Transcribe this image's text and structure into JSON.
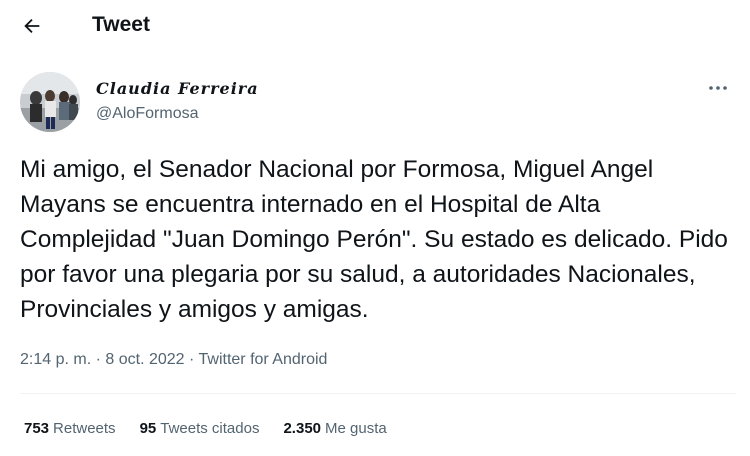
{
  "header": {
    "title": "Tweet",
    "back_icon": "back-arrow-icon"
  },
  "author": {
    "name": "Claudia Ferreira",
    "handle": "@AloFormosa"
  },
  "tweet": {
    "text": "Mi amigo, el Senador Nacional por Formosa, Miguel Angel Mayans se encuentra internado en el Hospital de Alta Complejidad \"Juan Domingo Perón\". Su estado es delicado. Pido por favor una plegaria por su salud, a autoridades Nacionales, Provinciales y amigos y amigas.",
    "time": "2:14 p. m.",
    "date": "8 oct. 2022",
    "source": "Twitter for Android",
    "separator": "·"
  },
  "stats": {
    "retweets_count": "753",
    "retweets_label": "Retweets",
    "quotes_count": "95",
    "quotes_label": "Tweets citados",
    "likes_count": "2.350",
    "likes_label": "Me gusta"
  },
  "colors": {
    "text_primary": "#0f1419",
    "text_secondary": "#536471",
    "divider": "#eff3f4"
  }
}
